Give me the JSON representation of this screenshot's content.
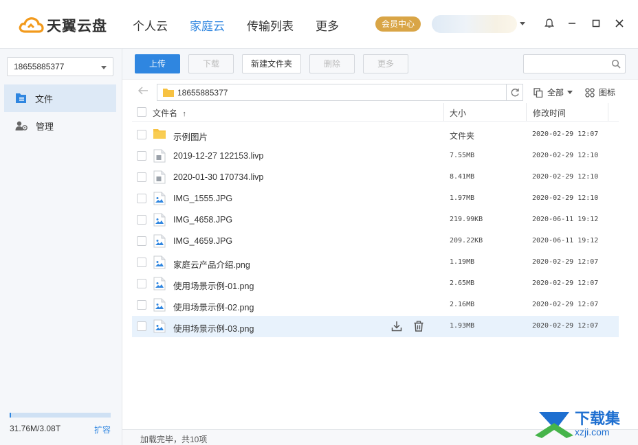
{
  "app": {
    "logo_text": "天翼云盘"
  },
  "nav": {
    "tabs": [
      "个人云",
      "家庭云",
      "传输列表",
      "更多"
    ],
    "active_index": 1
  },
  "header": {
    "vip_label": "会员中心"
  },
  "sidebar": {
    "account": "18655885377",
    "items": [
      {
        "label": "文件",
        "icon": "file-icon",
        "active": true
      },
      {
        "label": "管理",
        "icon": "user-manage-icon",
        "active": false
      }
    ],
    "quota_text": "31.76M/3.08T",
    "quota_fraction": 0.015,
    "expand_label": "扩容"
  },
  "toolbar": {
    "upload": "上传",
    "download": "下载",
    "new_folder": "新建文件夹",
    "delete": "删除",
    "more": "更多",
    "search_placeholder": ""
  },
  "path": {
    "current": "18655885377",
    "view_filter": "全部",
    "view_mode": "图标"
  },
  "table": {
    "headers": {
      "name": "文件名",
      "size": "大小",
      "modified": "修改时间"
    },
    "sort_indicator": "↑",
    "rows": [
      {
        "name": "示例图片",
        "size": "文件夹",
        "date": "2020-02-29 12:07",
        "type": "folder"
      },
      {
        "name": "2019-12-27 122153.livp",
        "size": "7.55MB",
        "date": "2020-02-29 12:10",
        "type": "file"
      },
      {
        "name": "2020-01-30 170734.livp",
        "size": "8.41MB",
        "date": "2020-02-29 12:10",
        "type": "file"
      },
      {
        "name": "IMG_1555.JPG",
        "size": "1.97MB",
        "date": "2020-02-29 12:10",
        "type": "image"
      },
      {
        "name": "IMG_4658.JPG",
        "size": "219.99KB",
        "date": "2020-06-11 19:12",
        "type": "image"
      },
      {
        "name": "IMG_4659.JPG",
        "size": "209.22KB",
        "date": "2020-06-11 19:12",
        "type": "image"
      },
      {
        "name": "家庭云产品介绍.png",
        "size": "1.19MB",
        "date": "2020-02-29 12:07",
        "type": "image"
      },
      {
        "name": "使用场景示例-01.png",
        "size": "2.65MB",
        "date": "2020-02-29 12:07",
        "type": "image"
      },
      {
        "name": "使用场景示例-02.png",
        "size": "2.16MB",
        "date": "2020-02-29 12:07",
        "type": "image"
      },
      {
        "name": "使用场景示例-03.png",
        "size": "1.93MB",
        "date": "2020-02-29 12:07",
        "type": "image"
      }
    ]
  },
  "status": {
    "text": "加载完毕，共10项"
  },
  "watermark": {
    "line1": "下载集",
    "line2": "xzji.com"
  },
  "colors": {
    "accent": "#2f86e0",
    "vip": "#d9a546",
    "folder": "#f7c242"
  }
}
